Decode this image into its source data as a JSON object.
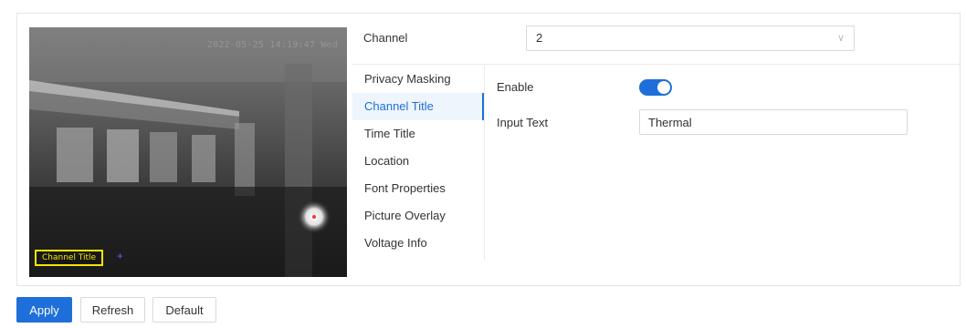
{
  "preview": {
    "timestamp": "2022-05-25 14:19:47 Wed",
    "osd_channel_title": "Channel Title"
  },
  "channel": {
    "label": "Channel",
    "value": "2"
  },
  "menu": {
    "items": [
      {
        "label": "Privacy Masking"
      },
      {
        "label": "Channel Title"
      },
      {
        "label": "Time Title"
      },
      {
        "label": "Location"
      },
      {
        "label": "Font Properties"
      },
      {
        "label": "Picture Overlay"
      },
      {
        "label": "Voltage Info"
      }
    ],
    "active": "Channel Title"
  },
  "form": {
    "enable_label": "Enable",
    "enable_on": true,
    "input_text_label": "Input Text",
    "input_text_value": "Thermal"
  },
  "buttons": {
    "apply": "Apply",
    "refresh": "Refresh",
    "default": "Default"
  },
  "colors": {
    "accent": "#1e6fd9",
    "osd_border": "#f5e500"
  },
  "icons": {
    "select_arrow": "chevron-down-icon"
  }
}
